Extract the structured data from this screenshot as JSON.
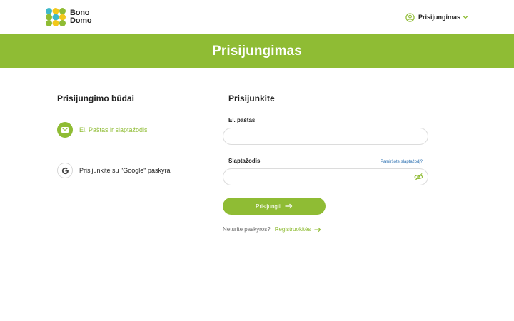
{
  "brand": {
    "line1": "Bono",
    "line2": "Domo",
    "colors": {
      "green": "#8fbc34",
      "yellow": "#f2c81b",
      "teal": "#3fb8c9"
    }
  },
  "header": {
    "account_label": "Prisijungimas",
    "account_icon": "user-circle-icon",
    "chevron_icon": "chevron-down-icon"
  },
  "banner": {
    "title": "Prisijungimas"
  },
  "methods": {
    "title": "Prisijungimo būdai",
    "items": [
      {
        "label": "El. Paštas ir slaptažodis",
        "icon": "mail-icon",
        "active": true
      },
      {
        "label": "Prisijunkite su \"Google\" paskyra",
        "icon": "google-icon",
        "active": false
      }
    ]
  },
  "form": {
    "title": "Prisijunkite",
    "email_label": "El. paštas",
    "email_value": "",
    "password_label": "Slaptažodis",
    "password_value": "",
    "forgot_label": "Pamiršote slaptažodį?",
    "submit_label": "Prisijungti",
    "no_account": "Neturite paskyros?",
    "register_label": "Registruokitės"
  }
}
